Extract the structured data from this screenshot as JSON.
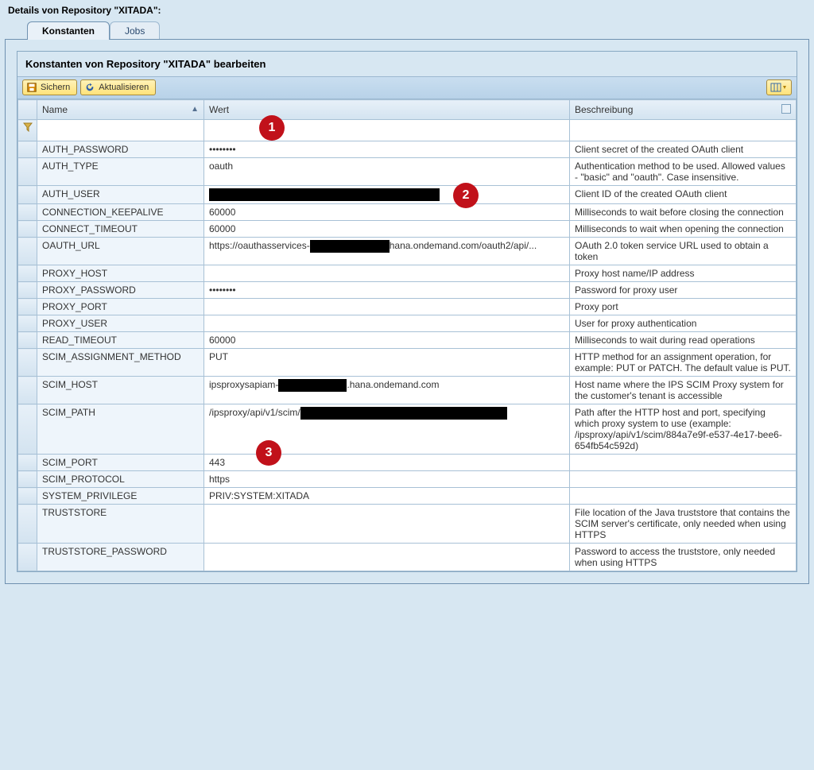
{
  "header": {
    "title": "Details von Repository \"XITADA\":"
  },
  "tabs": {
    "konstanten": "Konstanten",
    "jobs": "Jobs"
  },
  "panel": {
    "title": "Konstanten von Repository \"XITADA\" bearbeiten"
  },
  "toolbar": {
    "sichern": "Sichern",
    "aktualisieren": "Aktualisieren"
  },
  "columns": {
    "name": "Name",
    "wert": "Wert",
    "beschreibung": "Beschreibung"
  },
  "callouts": {
    "c1": "1",
    "c2": "2",
    "c3": "3"
  },
  "rows": [
    {
      "name": "AUTH_PASSWORD",
      "wert": "••••••••",
      "redact_w": 0,
      "beschr": "Client secret of the created OAuth client"
    },
    {
      "name": "AUTH_TYPE",
      "wert": "oauth",
      "redact_w": 0,
      "beschr": "Authentication method to be used. Allowed values - \"basic\" and \"oauth\". Case insensitive."
    },
    {
      "name": "AUTH_USER",
      "wert": "",
      "redact_w": 290,
      "beschr": "Client ID of the created OAuth client"
    },
    {
      "name": "CONNECTION_KEEPALIVE",
      "wert": "60000",
      "redact_w": 0,
      "beschr": "Milliseconds to wait before closing the connection"
    },
    {
      "name": "CONNECT_TIMEOUT",
      "wert": "60000",
      "redact_w": 0,
      "beschr": "Milliseconds to wait when opening the connection"
    },
    {
      "name": "OAUTH_URL",
      "wert_pre": "https://oauthasservices-",
      "redact_w": 100,
      "wert_post": "hana.ondemand.com/oauth2/api/...",
      "beschr": "OAuth 2.0 token service URL used to obtain a token"
    },
    {
      "name": "PROXY_HOST",
      "wert": "",
      "redact_w": 0,
      "beschr": "Proxy host name/IP address"
    },
    {
      "name": "PROXY_PASSWORD",
      "wert": "••••••••",
      "redact_w": 0,
      "beschr": "Password for proxy user"
    },
    {
      "name": "PROXY_PORT",
      "wert": "",
      "redact_w": 0,
      "beschr": "Proxy port"
    },
    {
      "name": "PROXY_USER",
      "wert": "",
      "redact_w": 0,
      "beschr": "User for proxy authentication"
    },
    {
      "name": "READ_TIMEOUT",
      "wert": "60000",
      "redact_w": 0,
      "beschr": "Milliseconds to wait during read operations"
    },
    {
      "name": "SCIM_ASSIGNMENT_METHOD",
      "wert": "PUT",
      "redact_w": 0,
      "beschr": "HTTP method for an assignment operation, for example: PUT or PATCH. The default value is PUT."
    },
    {
      "name": "SCIM_HOST",
      "wert_pre": "ipsproxysapiam-",
      "redact_w": 86,
      "wert_post": ".hana.ondemand.com",
      "beschr": "Host name where the IPS SCIM Proxy system for the customer's tenant is accessible"
    },
    {
      "name": "SCIM_PATH",
      "wert_pre": "/ipsproxy/api/v1/scim/",
      "redact_w": 260,
      "wert_post": "",
      "beschr": "Path after the HTTP host and port, specifying which proxy system to use (example: /ipsproxy/api/v1/scim/884a7e9f-e537-4e17-bee6-654fb54c592d)"
    },
    {
      "name": "SCIM_PORT",
      "wert": "443",
      "redact_w": 0,
      "beschr": ""
    },
    {
      "name": "SCIM_PROTOCOL",
      "wert": "https",
      "redact_w": 0,
      "beschr": ""
    },
    {
      "name": "SYSTEM_PRIVILEGE",
      "wert": " PRIV:SYSTEM:XITADA",
      "redact_w": 0,
      "beschr": ""
    },
    {
      "name": "TRUSTSTORE",
      "wert": "",
      "redact_w": 0,
      "beschr": "File location of the Java truststore that contains the SCIM server's certificate, only needed when using HTTPS"
    },
    {
      "name": "TRUSTSTORE_PASSWORD",
      "wert": "",
      "redact_w": 0,
      "beschr": "Password to access the truststore, only needed when using HTTPS"
    }
  ]
}
